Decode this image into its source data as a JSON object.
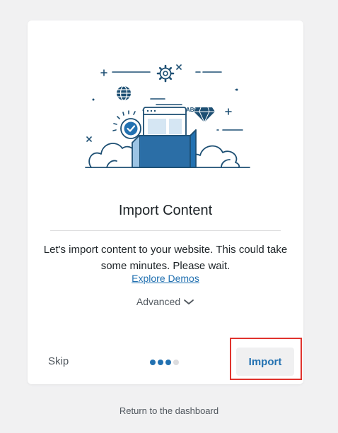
{
  "card": {
    "title": "Import Content",
    "description": "Let's import content to your website. This could take some minutes. Please wait.",
    "explore_link": "Explore Demos",
    "advanced_label": "Advanced",
    "illustration_text": "ABC",
    "skip_label": "Skip",
    "import_label": "Import",
    "progress": {
      "total_steps": 4,
      "completed_steps": 3,
      "active_color": "#2271b1",
      "inactive_color": "#dcdcde"
    }
  },
  "footer": {
    "return_link": "Return to the dashboard"
  },
  "colors": {
    "accent": "#2271b1",
    "highlight": "#e0332d",
    "background": "#f1f1f2"
  },
  "icons": [
    "gear-icon",
    "globe-icon",
    "diamond-icon",
    "checkmark-badge-icon",
    "browser-window-icon",
    "cloud-icon",
    "chevron-down-icon"
  ]
}
